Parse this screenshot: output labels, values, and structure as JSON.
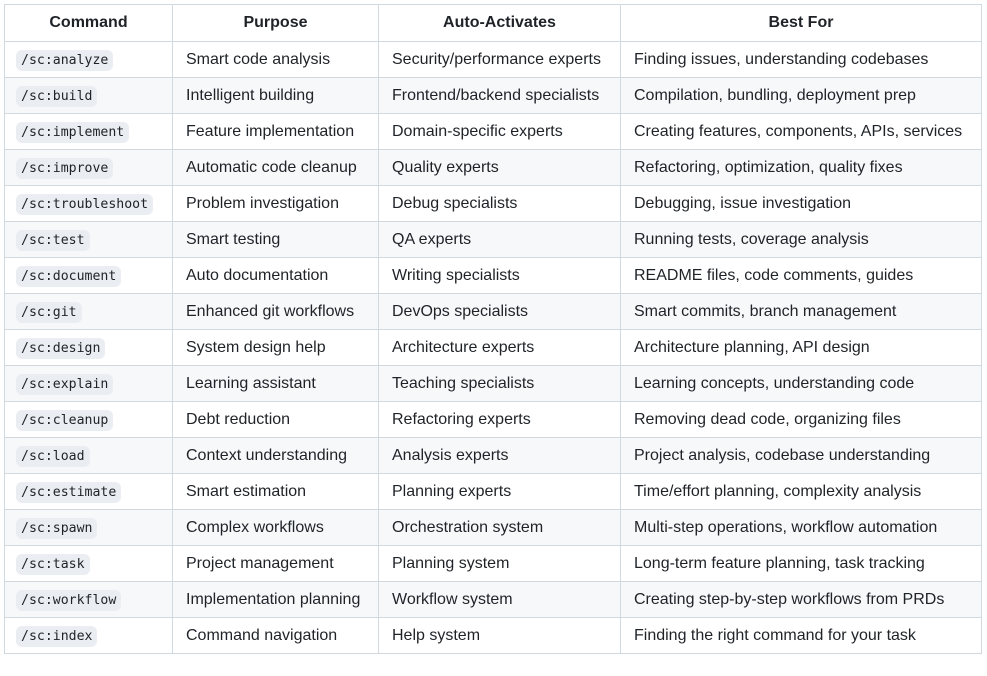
{
  "table": {
    "headers": [
      "Command",
      "Purpose",
      "Auto-Activates",
      "Best For"
    ],
    "rows": [
      {
        "command": "/sc:analyze",
        "purpose": "Smart code analysis",
        "auto": "Security/performance experts",
        "best": "Finding issues, understanding codebases"
      },
      {
        "command": "/sc:build",
        "purpose": "Intelligent building",
        "auto": "Frontend/backend specialists",
        "best": "Compilation, bundling, deployment prep"
      },
      {
        "command": "/sc:implement",
        "purpose": "Feature implementation",
        "auto": "Domain-specific experts",
        "best": "Creating features, components, APIs, services"
      },
      {
        "command": "/sc:improve",
        "purpose": "Automatic code cleanup",
        "auto": "Quality experts",
        "best": "Refactoring, optimization, quality fixes"
      },
      {
        "command": "/sc:troubleshoot",
        "purpose": "Problem investigation",
        "auto": "Debug specialists",
        "best": "Debugging, issue investigation"
      },
      {
        "command": "/sc:test",
        "purpose": "Smart testing",
        "auto": "QA experts",
        "best": "Running tests, coverage analysis"
      },
      {
        "command": "/sc:document",
        "purpose": "Auto documentation",
        "auto": "Writing specialists",
        "best": "README files, code comments, guides"
      },
      {
        "command": "/sc:git",
        "purpose": "Enhanced git workflows",
        "auto": "DevOps specialists",
        "best": "Smart commits, branch management"
      },
      {
        "command": "/sc:design",
        "purpose": "System design help",
        "auto": "Architecture experts",
        "best": "Architecture planning, API design"
      },
      {
        "command": "/sc:explain",
        "purpose": "Learning assistant",
        "auto": "Teaching specialists",
        "best": "Learning concepts, understanding code"
      },
      {
        "command": "/sc:cleanup",
        "purpose": "Debt reduction",
        "auto": "Refactoring experts",
        "best": "Removing dead code, organizing files"
      },
      {
        "command": "/sc:load",
        "purpose": "Context understanding",
        "auto": "Analysis experts",
        "best": "Project analysis, codebase understanding"
      },
      {
        "command": "/sc:estimate",
        "purpose": "Smart estimation",
        "auto": "Planning experts",
        "best": "Time/effort planning, complexity analysis"
      },
      {
        "command": "/sc:spawn",
        "purpose": "Complex workflows",
        "auto": "Orchestration system",
        "best": "Multi-step operations, workflow automation"
      },
      {
        "command": "/sc:task",
        "purpose": "Project management",
        "auto": "Planning system",
        "best": "Long-term feature planning, task tracking"
      },
      {
        "command": "/sc:workflow",
        "purpose": "Implementation planning",
        "auto": "Workflow system",
        "best": "Creating step-by-step workflows from PRDs"
      },
      {
        "command": "/sc:index",
        "purpose": "Command navigation",
        "auto": "Help system",
        "best": "Finding the right command for your task"
      }
    ]
  }
}
